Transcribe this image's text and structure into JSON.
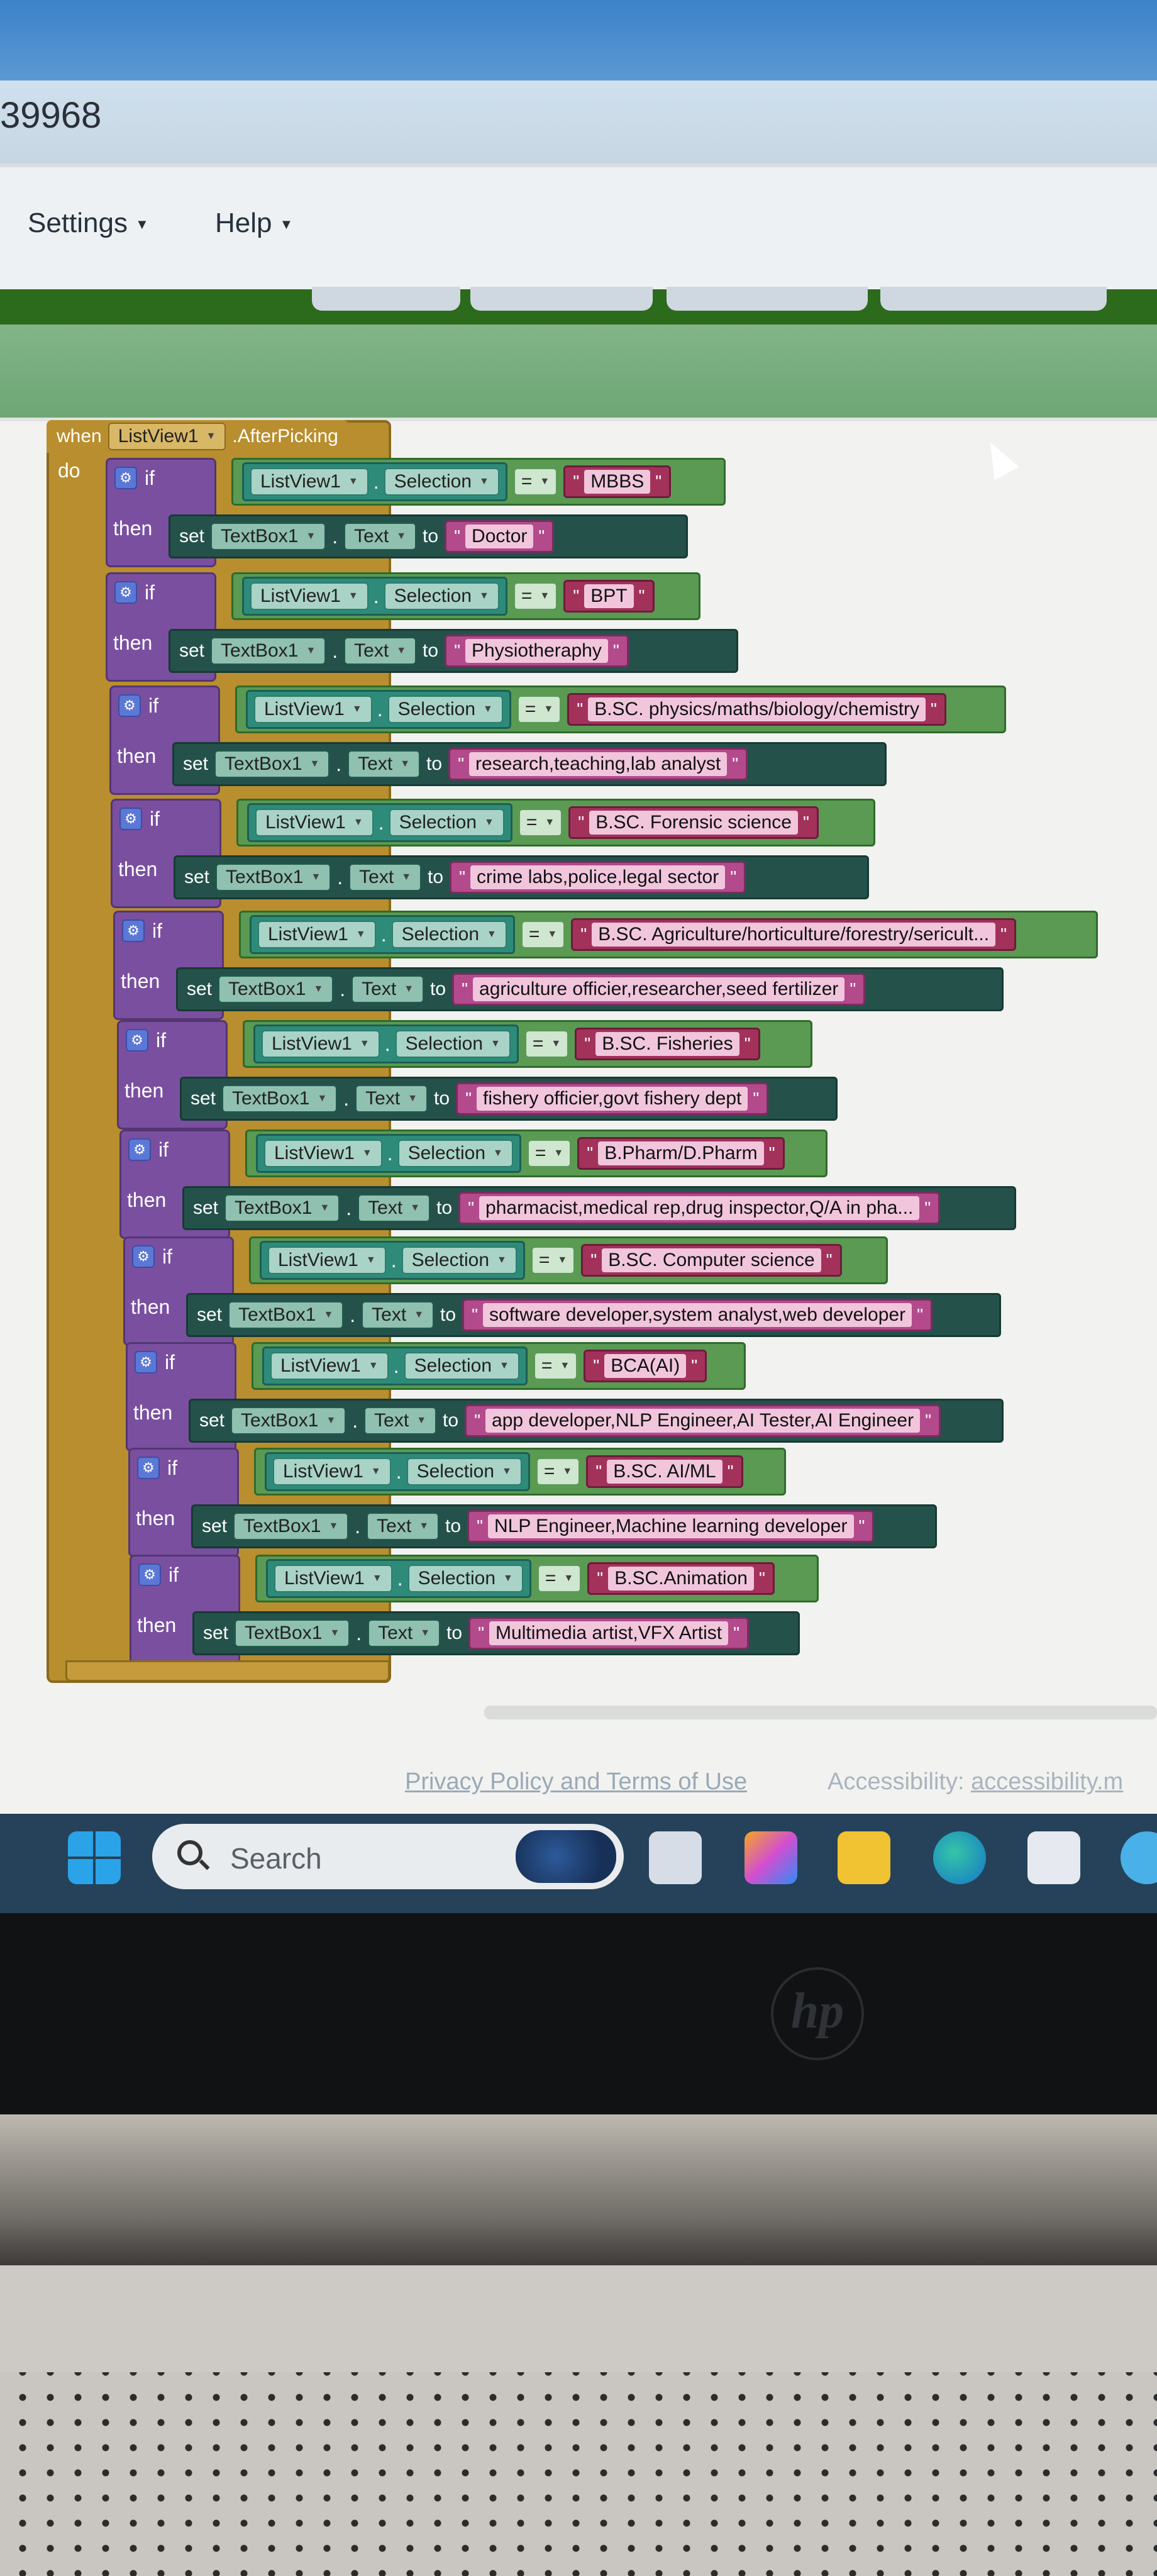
{
  "url_fragment": "39968",
  "menu": {
    "settings": "Settings",
    "help": "Help"
  },
  "event": {
    "when": "when",
    "component": "ListView1",
    "event_name": ".AfterPicking",
    "do": "do"
  },
  "keywords": {
    "if": "if",
    "then": "then",
    "set": "set",
    "to": "to",
    "dot": ".",
    "eq": "="
  },
  "conditions": [
    {
      "component": "ListView1",
      "property": "Selection",
      "op": "=",
      "value": "MBBS",
      "target": "TextBox1",
      "target_prop": "Text",
      "result": "Doctor"
    },
    {
      "component": "ListView1",
      "property": "Selection",
      "op": "=",
      "value": "BPT",
      "target": "TextBox1",
      "target_prop": "Text",
      "result": "Physiotheraphy"
    },
    {
      "component": "ListView1",
      "property": "Selection",
      "op": "=",
      "value": "B.SC. physics/maths/biology/chemistry",
      "target": "TextBox1",
      "target_prop": "Text",
      "result": "research,teaching,lab analyst"
    },
    {
      "component": "ListView1",
      "property": "Selection",
      "op": "=",
      "value": "B.SC. Forensic science",
      "target": "TextBox1",
      "target_prop": "Text",
      "result": "crime labs,police,legal sector"
    },
    {
      "component": "ListView1",
      "property": "Selection",
      "op": "=",
      "value": "B.SC. Agriculture/horticulture/forestry/sericult...",
      "target": "TextBox1",
      "target_prop": "Text",
      "result": "agriculture officier,researcher,seed fertilizer"
    },
    {
      "component": "ListView1",
      "property": "Selection",
      "op": "=",
      "value": "B.SC. Fisheries",
      "target": "TextBox1",
      "target_prop": "Text",
      "result": "fishery officier,govt fishery dept"
    },
    {
      "component": "ListView1",
      "property": "Selection",
      "op": "=",
      "value": "B.Pharm/D.Pharm",
      "target": "TextBox1",
      "target_prop": "Text",
      "result": "pharmacist,medical rep,drug inspector,Q/A in pha..."
    },
    {
      "component": "ListView1",
      "property": "Selection",
      "op": "=",
      "value": "B.SC. Computer science",
      "target": "TextBox1",
      "target_prop": "Text",
      "result": "software developer,system analyst,web developer"
    },
    {
      "component": "ListView1",
      "property": "Selection",
      "op": "=",
      "value": "BCA(AI)",
      "target": "TextBox1",
      "target_prop": "Text",
      "result": "app developer,NLP Engineer,AI Tester,AI Engineer"
    },
    {
      "component": "ListView1",
      "property": "Selection",
      "op": "=",
      "value": "B.SC. AI/ML",
      "target": "TextBox1",
      "target_prop": "Text",
      "result": "NLP Engineer,Machine learning developer"
    },
    {
      "component": "ListView1",
      "property": "Selection",
      "op": "=",
      "value": "B.SC.Animation",
      "target": "TextBox1",
      "target_prop": "Text",
      "result": "Multimedia artist,VFX Artist"
    }
  ],
  "footer": {
    "privacy": "Privacy Policy and Terms of Use",
    "accessibility_label": "Accessibility:",
    "accessibility_link": "accessibility.m"
  },
  "taskbar": {
    "search_placeholder": "Search"
  },
  "brand": "hp",
  "colors": {
    "event_block": "#b98e2e",
    "control_block": "#7a4fa0",
    "logic_block": "#5a9a53",
    "text_block": "#a3325b",
    "setter_block": "#24524a",
    "taskbar": "#25425a"
  }
}
